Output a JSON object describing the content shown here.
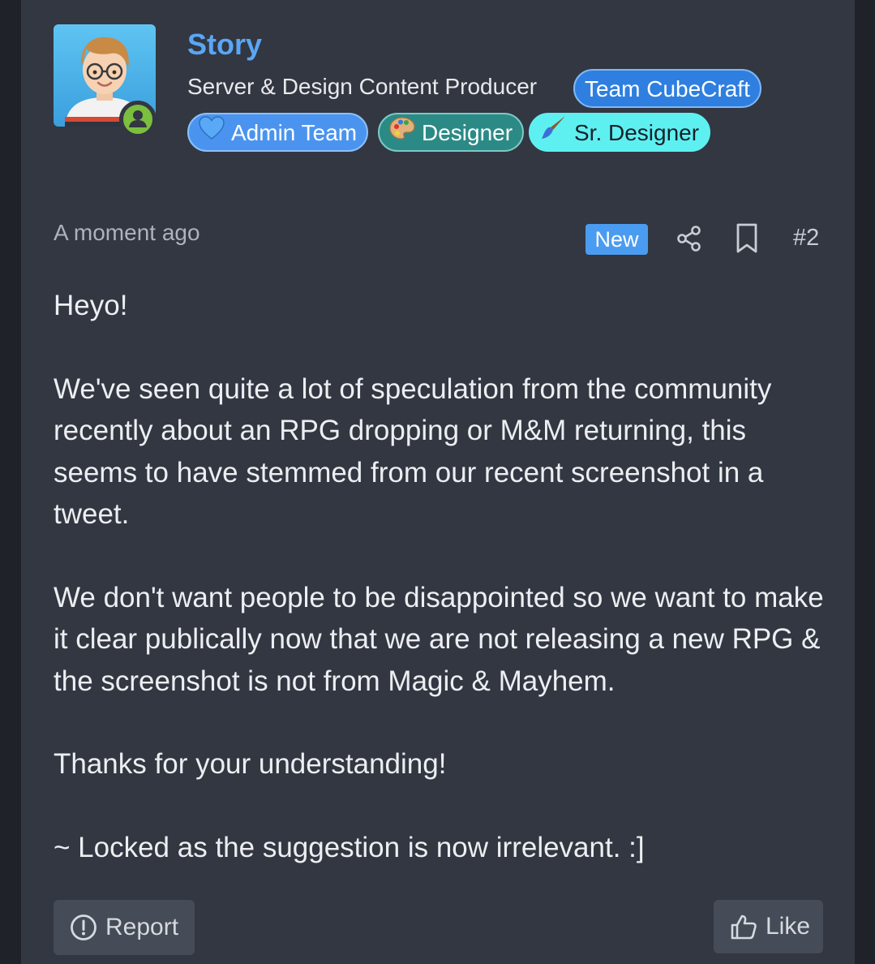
{
  "author": {
    "name": "Story",
    "title": "Server & Design Content Producer",
    "online": true
  },
  "badges": {
    "team": "Team CubeCraft",
    "admin": "Admin Team",
    "designer": "Designer",
    "sr_designer": "Sr. Designer"
  },
  "meta": {
    "timestamp": "A moment ago",
    "new_label": "New",
    "post_number": "#2"
  },
  "post": {
    "paragraphs": [
      "Heyo!",
      "We've seen quite a lot of speculation from the community recently about an RPG dropping or M&M returning, this seems to have stemmed from our recent screenshot in a tweet.",
      "We don't want people to be disappointed so we want to make it clear publically now that we are not releasing a new RPG & the screenshot is not from Magic & Mayhem.",
      "Thanks for your understanding!",
      "~ Locked as the suggestion is now irrelevant. :]"
    ]
  },
  "actions": {
    "report_label": "Report",
    "like_label": "Like"
  },
  "colors": {
    "card_background": "#323742",
    "username": "#5aa6f5",
    "new_badge": "#4a9cf0",
    "online": "#7bbf3f"
  },
  "icons": {
    "share": "share-icon",
    "bookmark": "bookmark-icon",
    "report": "exclamation-circle-icon",
    "like": "thumbs-up-icon",
    "admin_badge": "blue-heart-icon",
    "designer_badge": "palette-icon",
    "sr_designer_badge": "paintbrush-icon"
  }
}
